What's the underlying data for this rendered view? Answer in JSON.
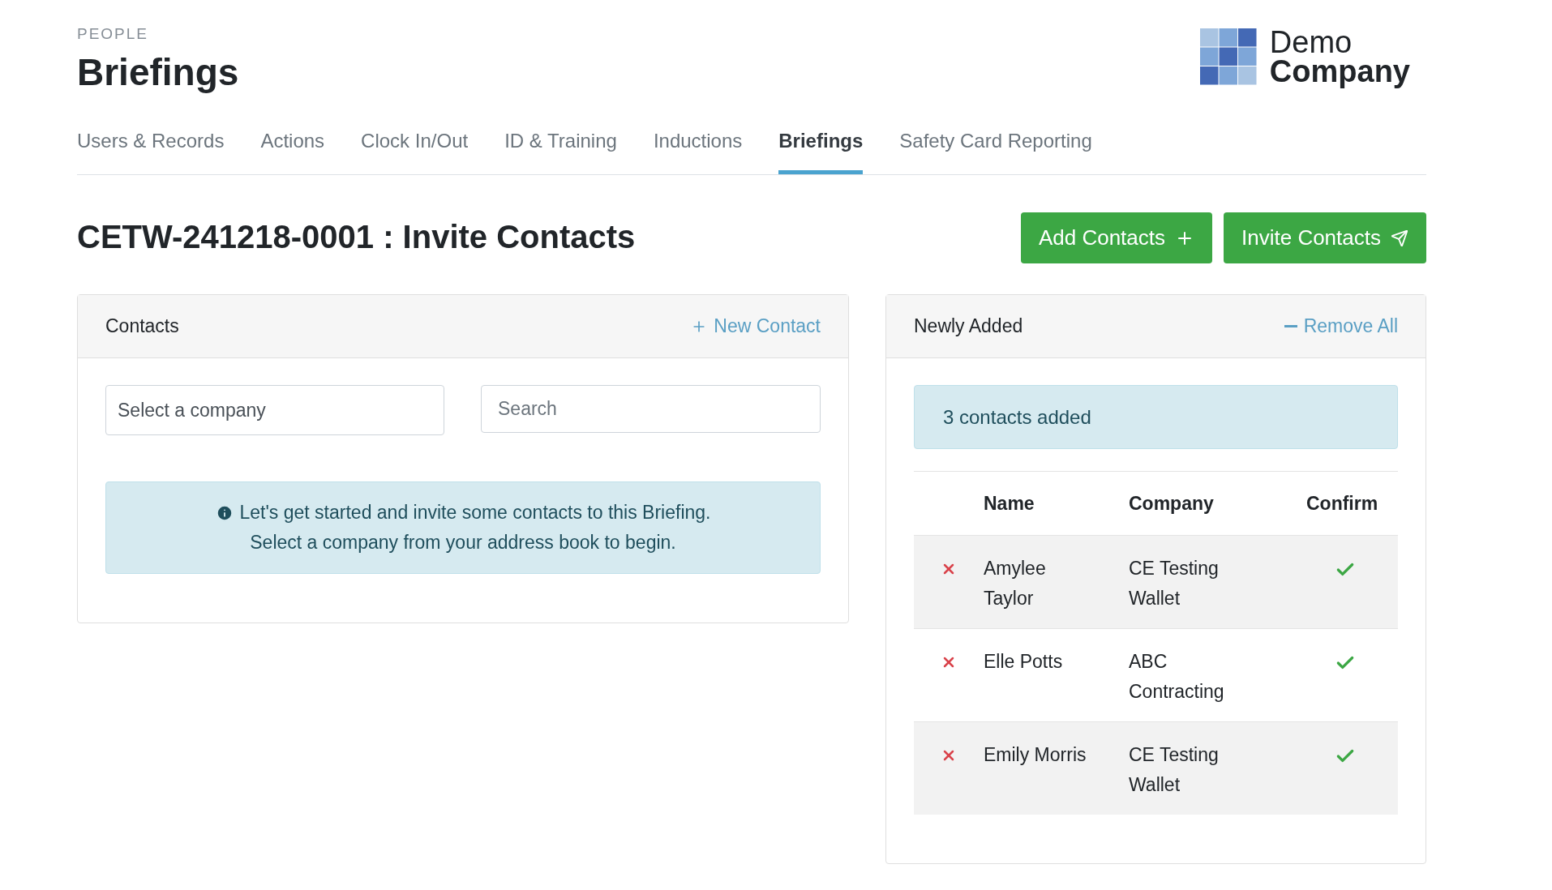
{
  "header": {
    "section": "PEOPLE",
    "title": "Briefings"
  },
  "logo": {
    "line_1": "Demo",
    "line_2": "Company"
  },
  "tabs": [
    {
      "label": "Users & Records",
      "selected": false
    },
    {
      "label": "Actions",
      "selected": false
    },
    {
      "label": "Clock In/Out",
      "selected": false
    },
    {
      "label": "ID & Training",
      "selected": false
    },
    {
      "label": "Inductions",
      "selected": false
    },
    {
      "label": "Briefings",
      "selected": true
    },
    {
      "label": "Safety Card Reporting",
      "selected": false
    }
  ],
  "page_title": "CETW-241218-0001 : Invite Contacts",
  "buttons": [
    {
      "label": "Add Contacts",
      "kind": "add"
    },
    {
      "label": "Invite Contacts",
      "kind": "send"
    }
  ],
  "contacts_panel": {
    "title": "Contacts",
    "action": "New Contact",
    "company_select": {
      "placeholder": "Select a company"
    },
    "search": {
      "placeholder": "Search"
    },
    "info_lines": [
      "Let's get started and invite some contacts to this Briefing.",
      "Select a company from your address book to begin."
    ]
  },
  "added_panel": {
    "title": "Newly Added",
    "action": "Remove All",
    "notice": "3 contacts added",
    "columns": [
      "Name",
      "Company",
      "Confirm"
    ],
    "rows": [
      {
        "name": "Amylee Taylor",
        "company": "CE Testing Wallet",
        "confirmed": true
      },
      {
        "name": "Elle Potts",
        "company": "ABC Contracting",
        "confirmed": true
      },
      {
        "name": "Emily Morris",
        "company": "CE Testing Wallet",
        "confirmed": true
      }
    ]
  }
}
